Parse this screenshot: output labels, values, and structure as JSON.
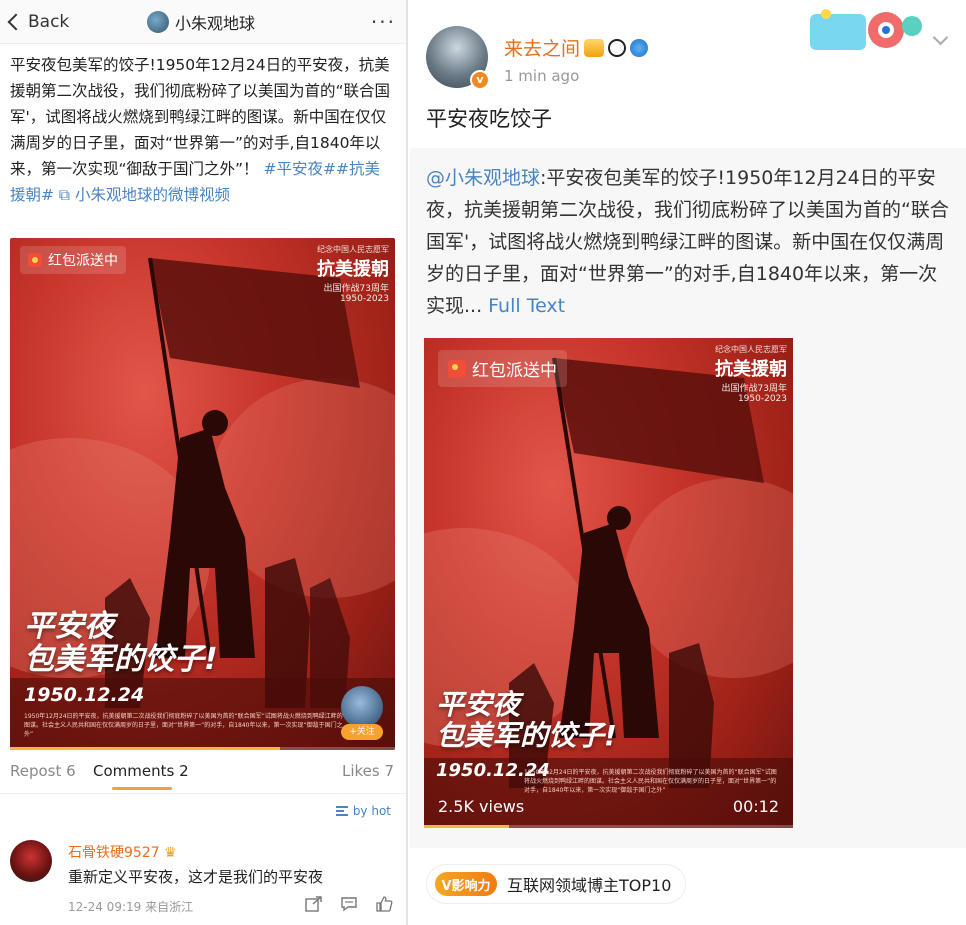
{
  "left": {
    "back_label": "Back",
    "nav_title": "小朱观地球",
    "more_label": "···",
    "post_text_main": "平安夜包美军的饺子!1950年12月24日的平安夜，抗美援朝第二次战役，我们彻底粉碎了以美国为首的“联合国军'，试图将战火燃烧到鸭绿江畔的图谋。新中国在仅仅满周岁的日子里，面对“世界第一”的对手,自1840年以来，第一次实现“御敌于国门之外”！",
    "post_text_tags": "#平安夜##抗美援朝# ",
    "post_text_video_link": "小朱观地球的微博视频",
    "counts": {
      "repost": "Repost 6",
      "comments": "Comments 2",
      "likes": "Likes 7"
    },
    "sort_label": "by hot",
    "comment": {
      "name": "石骨铁硬9527",
      "text": "重新定义平安夜，这才是我们的平安夜",
      "meta": "12-24 09:19  来自浙江"
    },
    "follow_label": "+关注",
    "video_progress": 0.7
  },
  "poster": {
    "tag": "红包派送中",
    "brand_line1": "纪念中国人民志愿军",
    "brand_line2": "抗美援朝",
    "brand_line3": "出国作战73周年",
    "brand_line4": "1950-2023",
    "headline1": "平安夜",
    "headline2": "包美军的饺子!",
    "date": "1950.12.24",
    "fine_print": "1950年12月24日的平安夜，抗美援朝第二次战役我们彻底粉碎了以美国为首的“联合国军”试图将战火燃烧到鸭绿江畔的图谋。社会主义人民共和国在仅仅满周岁的日子里，面对“世界第一”的对手，自1840年以来，第一次实现“御敌于国门之外”"
  },
  "right": {
    "name": "来去之间",
    "time": "1 min ago",
    "title": "平安夜吃饺子",
    "quote_mention": "@小朱观地球",
    "quote_text": ":平安夜包美军的饺子!1950年12月24日的平安夜，抗美援朝第二次战役，我们彻底粉碎了以美国为首的“联合国军'，试图将战火燃烧到鸭绿江畔的图谋。新中国在仅仅满周岁的日子里，面对“世界第一”的对手,自1840年以来，第一次实现...",
    "full_text_label": " Full Text",
    "video_views": "2.5K views",
    "video_duration": "00:12",
    "video_progress": 0.23,
    "influence_badge": "V影响力",
    "influence_text": "互联网领域博主TOP10"
  },
  "colors": {
    "link": "#4a84c1",
    "username": "#e86d1c",
    "accent_underline": "#f0a23a",
    "poster_red": "#c7352b"
  }
}
